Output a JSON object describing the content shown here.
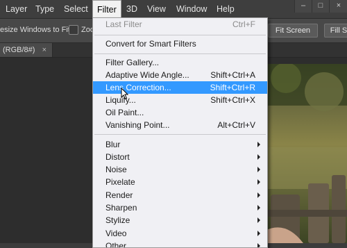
{
  "menubar": {
    "items": [
      "Layer",
      "Type",
      "Select",
      "Filter",
      "3D",
      "View",
      "Window",
      "Help"
    ],
    "active": "Filter"
  },
  "options_bar": {
    "resize_label": "esize Windows to Fit",
    "zoom_label": "Zoo",
    "fit_screen": "Fit Screen",
    "fill_screen": "Fill S"
  },
  "document_tab": {
    "title": "(RGB/8#)",
    "close": "×"
  },
  "filter_menu": {
    "last_filter": {
      "label": "Last Filter",
      "shortcut": "Ctrl+F"
    },
    "convert_smart": "Convert for Smart Filters",
    "filter_gallery": "Filter Gallery...",
    "adaptive_wide_angle": {
      "label": "Adaptive Wide Angle...",
      "shortcut": "Shift+Ctrl+A"
    },
    "lens_correction": {
      "label": "Lens Correction...",
      "shortcut": "Shift+Ctrl+R"
    },
    "liquify": {
      "label": "Liquify...",
      "shortcut": "Shift+Ctrl+X"
    },
    "oil_paint": "Oil Paint...",
    "vanishing_point": {
      "label": "Vanishing Point...",
      "shortcut": "Alt+Ctrl+V"
    },
    "submenus": [
      "Blur",
      "Distort",
      "Noise",
      "Pixelate",
      "Render",
      "Sharpen",
      "Stylize",
      "Video",
      "Other"
    ]
  },
  "colors": {
    "highlight": "#3399ff",
    "menu_bg": "#f0f0f4",
    "app_bg": "#3c3c3c"
  }
}
